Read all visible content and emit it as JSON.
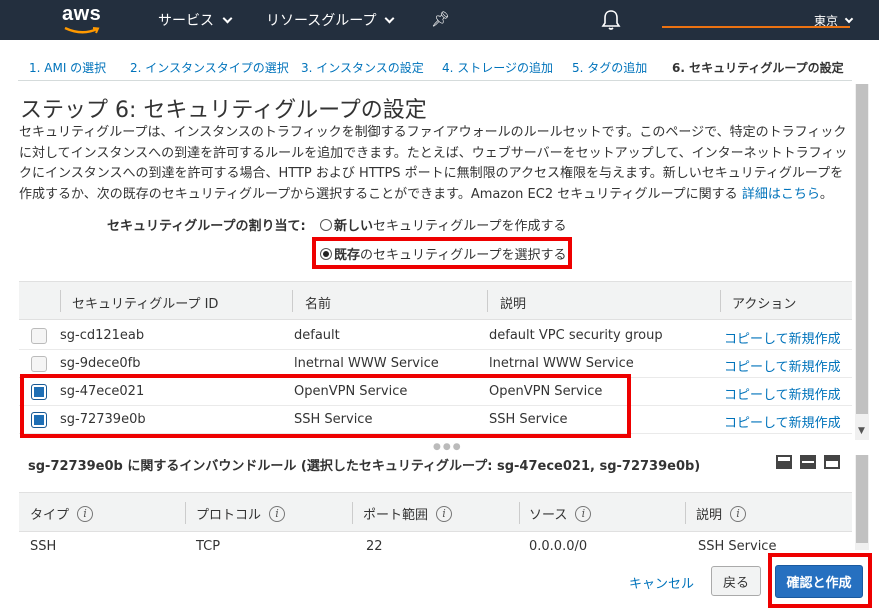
{
  "nav": {
    "logo": "aws",
    "services": "サービス",
    "resource_groups": "リソースグループ",
    "region": "東京"
  },
  "steps": [
    {
      "label": "1. AMI の選択"
    },
    {
      "label": "2. インスタンスタイプの選択"
    },
    {
      "label": "3. インスタンスの設定"
    },
    {
      "label": "4. ストレージの追加"
    },
    {
      "label": "5. タグの追加"
    },
    {
      "label": "6. セキュリティグループの設定"
    }
  ],
  "page": {
    "title": "ステップ 6: セキュリティグループの設定",
    "description": "セキュリティグループは、インスタンスのトラフィックを制御するファイアウォールのルールセットです。このページで、特定のトラフィックに対してインスタンスへの到達を許可するルールを追加できます。たとえば、ウェブサーバーをセットアップして、インターネットトラフィックにインスタンスへの到達を許可する場合、HTTP および HTTPS ポートに無制限のアクセス権限を与えます。新しいセキュリティグループを作成するか、次の既存のセキュリティグループから選択することができます。Amazon EC2 セキュリティグループに関する",
    "details_link": "詳細はこちら",
    "details_suffix": "。"
  },
  "assign": {
    "label": "セキュリティグループの割り当て:",
    "option_new_bold": "新しい",
    "option_new_rest": "セキュリティグループを作成する",
    "option_existing_bold": "既存",
    "option_existing_rest": "のセキュリティグループを選択する"
  },
  "sg_table": {
    "headers": {
      "id": "セキュリティグループ ID",
      "name": "名前",
      "description": "説明",
      "action": "アクション"
    },
    "rows": [
      {
        "id": "sg-cd121eab",
        "name": "default",
        "description": "default VPC security group",
        "action": "コピーして新規作成"
      },
      {
        "id": "sg-9dece0fb",
        "name": "lnetrnal WWW Service",
        "description": "lnetrnal WWW Service",
        "action": "コピーして新規作成"
      },
      {
        "id": "sg-47ece021",
        "name": "OpenVPN Service",
        "description": "OpenVPN Service",
        "action": "コピーして新規作成"
      },
      {
        "id": "sg-72739e0b",
        "name": "SSH Service",
        "description": "SSH Service",
        "action": "コピーして新規作成"
      }
    ]
  },
  "inbound": {
    "title": "sg-72739e0b に関するインバウンドルール (選択したセキュリティグループ: sg-47ece021, sg-72739e0b)",
    "headers": {
      "type": "タイプ",
      "protocol": "プロトコル",
      "port": "ポート範囲",
      "source": "ソース",
      "description": "説明"
    },
    "rows": [
      {
        "type": "SSH",
        "protocol": "TCP",
        "port": "22",
        "source": "0.0.0.0/0",
        "description": "SSH Service"
      }
    ]
  },
  "footer": {
    "cancel": "キャンセル",
    "back": "戻る",
    "confirm": "確認と作成"
  }
}
